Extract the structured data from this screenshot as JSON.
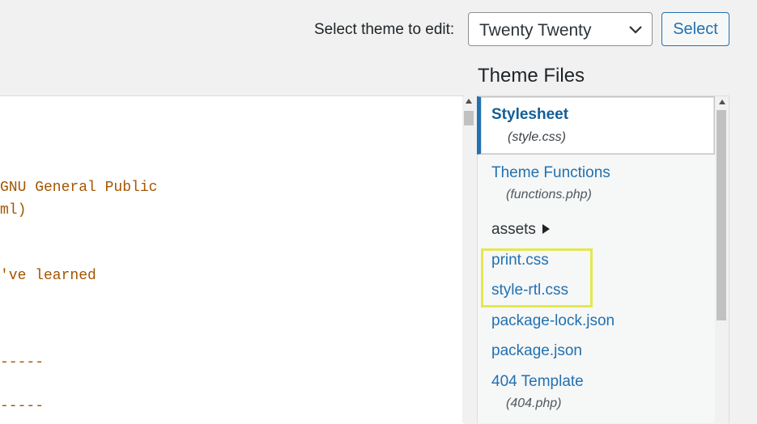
{
  "header": {
    "select_label": "Select theme to edit:",
    "selected_theme": "Twenty Twenty",
    "select_button": "Select"
  },
  "sidebar": {
    "title": "Theme Files",
    "active_file": {
      "name": "Stylesheet",
      "file": "(style.css)"
    },
    "files": [
      {
        "name": "Theme Functions",
        "file": "(functions.php)"
      },
      {
        "name": "assets",
        "folder": true
      },
      {
        "name": "print.css"
      },
      {
        "name": "style-rtl.css"
      },
      {
        "name": "package-lock.json"
      },
      {
        "name": "package.json"
      },
      {
        "name": "404 Template",
        "file": "(404.php)"
      }
    ],
    "highlight_color": "#e4e84f"
  },
  "editor": {
    "lines": [
      "GNU General Public",
      "ml)",
      "'ve learned",
      "-----",
      "-----"
    ]
  },
  "colors": {
    "link": "#2271b1",
    "code": "#a35600",
    "background": "#f1f1f1"
  }
}
